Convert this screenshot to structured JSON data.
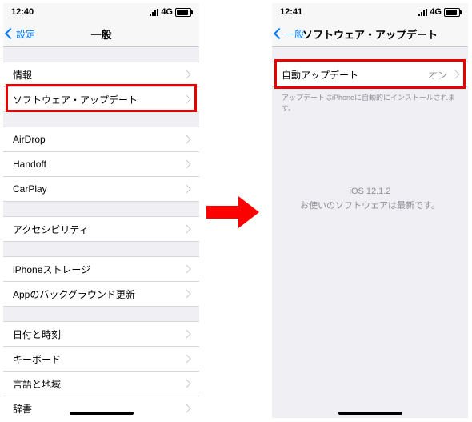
{
  "left": {
    "status": {
      "time": "12:40",
      "network": "4G"
    },
    "nav": {
      "back": "設定",
      "title": "一般"
    },
    "g1": [
      {
        "label": "情報"
      },
      {
        "label": "ソフトウェア・アップデート"
      }
    ],
    "g2": [
      {
        "label": "AirDrop"
      },
      {
        "label": "Handoff"
      },
      {
        "label": "CarPlay"
      }
    ],
    "g3": [
      {
        "label": "アクセシビリティ"
      }
    ],
    "g4": [
      {
        "label": "iPhoneストレージ"
      },
      {
        "label": "Appのバックグラウンド更新"
      }
    ],
    "g5": [
      {
        "label": "日付と時刻"
      },
      {
        "label": "キーボード"
      },
      {
        "label": "言語と地域"
      },
      {
        "label": "辞書"
      }
    ]
  },
  "right": {
    "status": {
      "time": "12:41",
      "network": "4G"
    },
    "nav": {
      "back": "一般",
      "title": "ソフトウェア・アップデート"
    },
    "row": {
      "label": "自動アップデート",
      "value": "オン"
    },
    "footnote": "アップデートはiPhoneに自動的にインストールされます。",
    "center1": "iOS 12.1.2",
    "center2": "お使いのソフトウェアは最新です。"
  }
}
